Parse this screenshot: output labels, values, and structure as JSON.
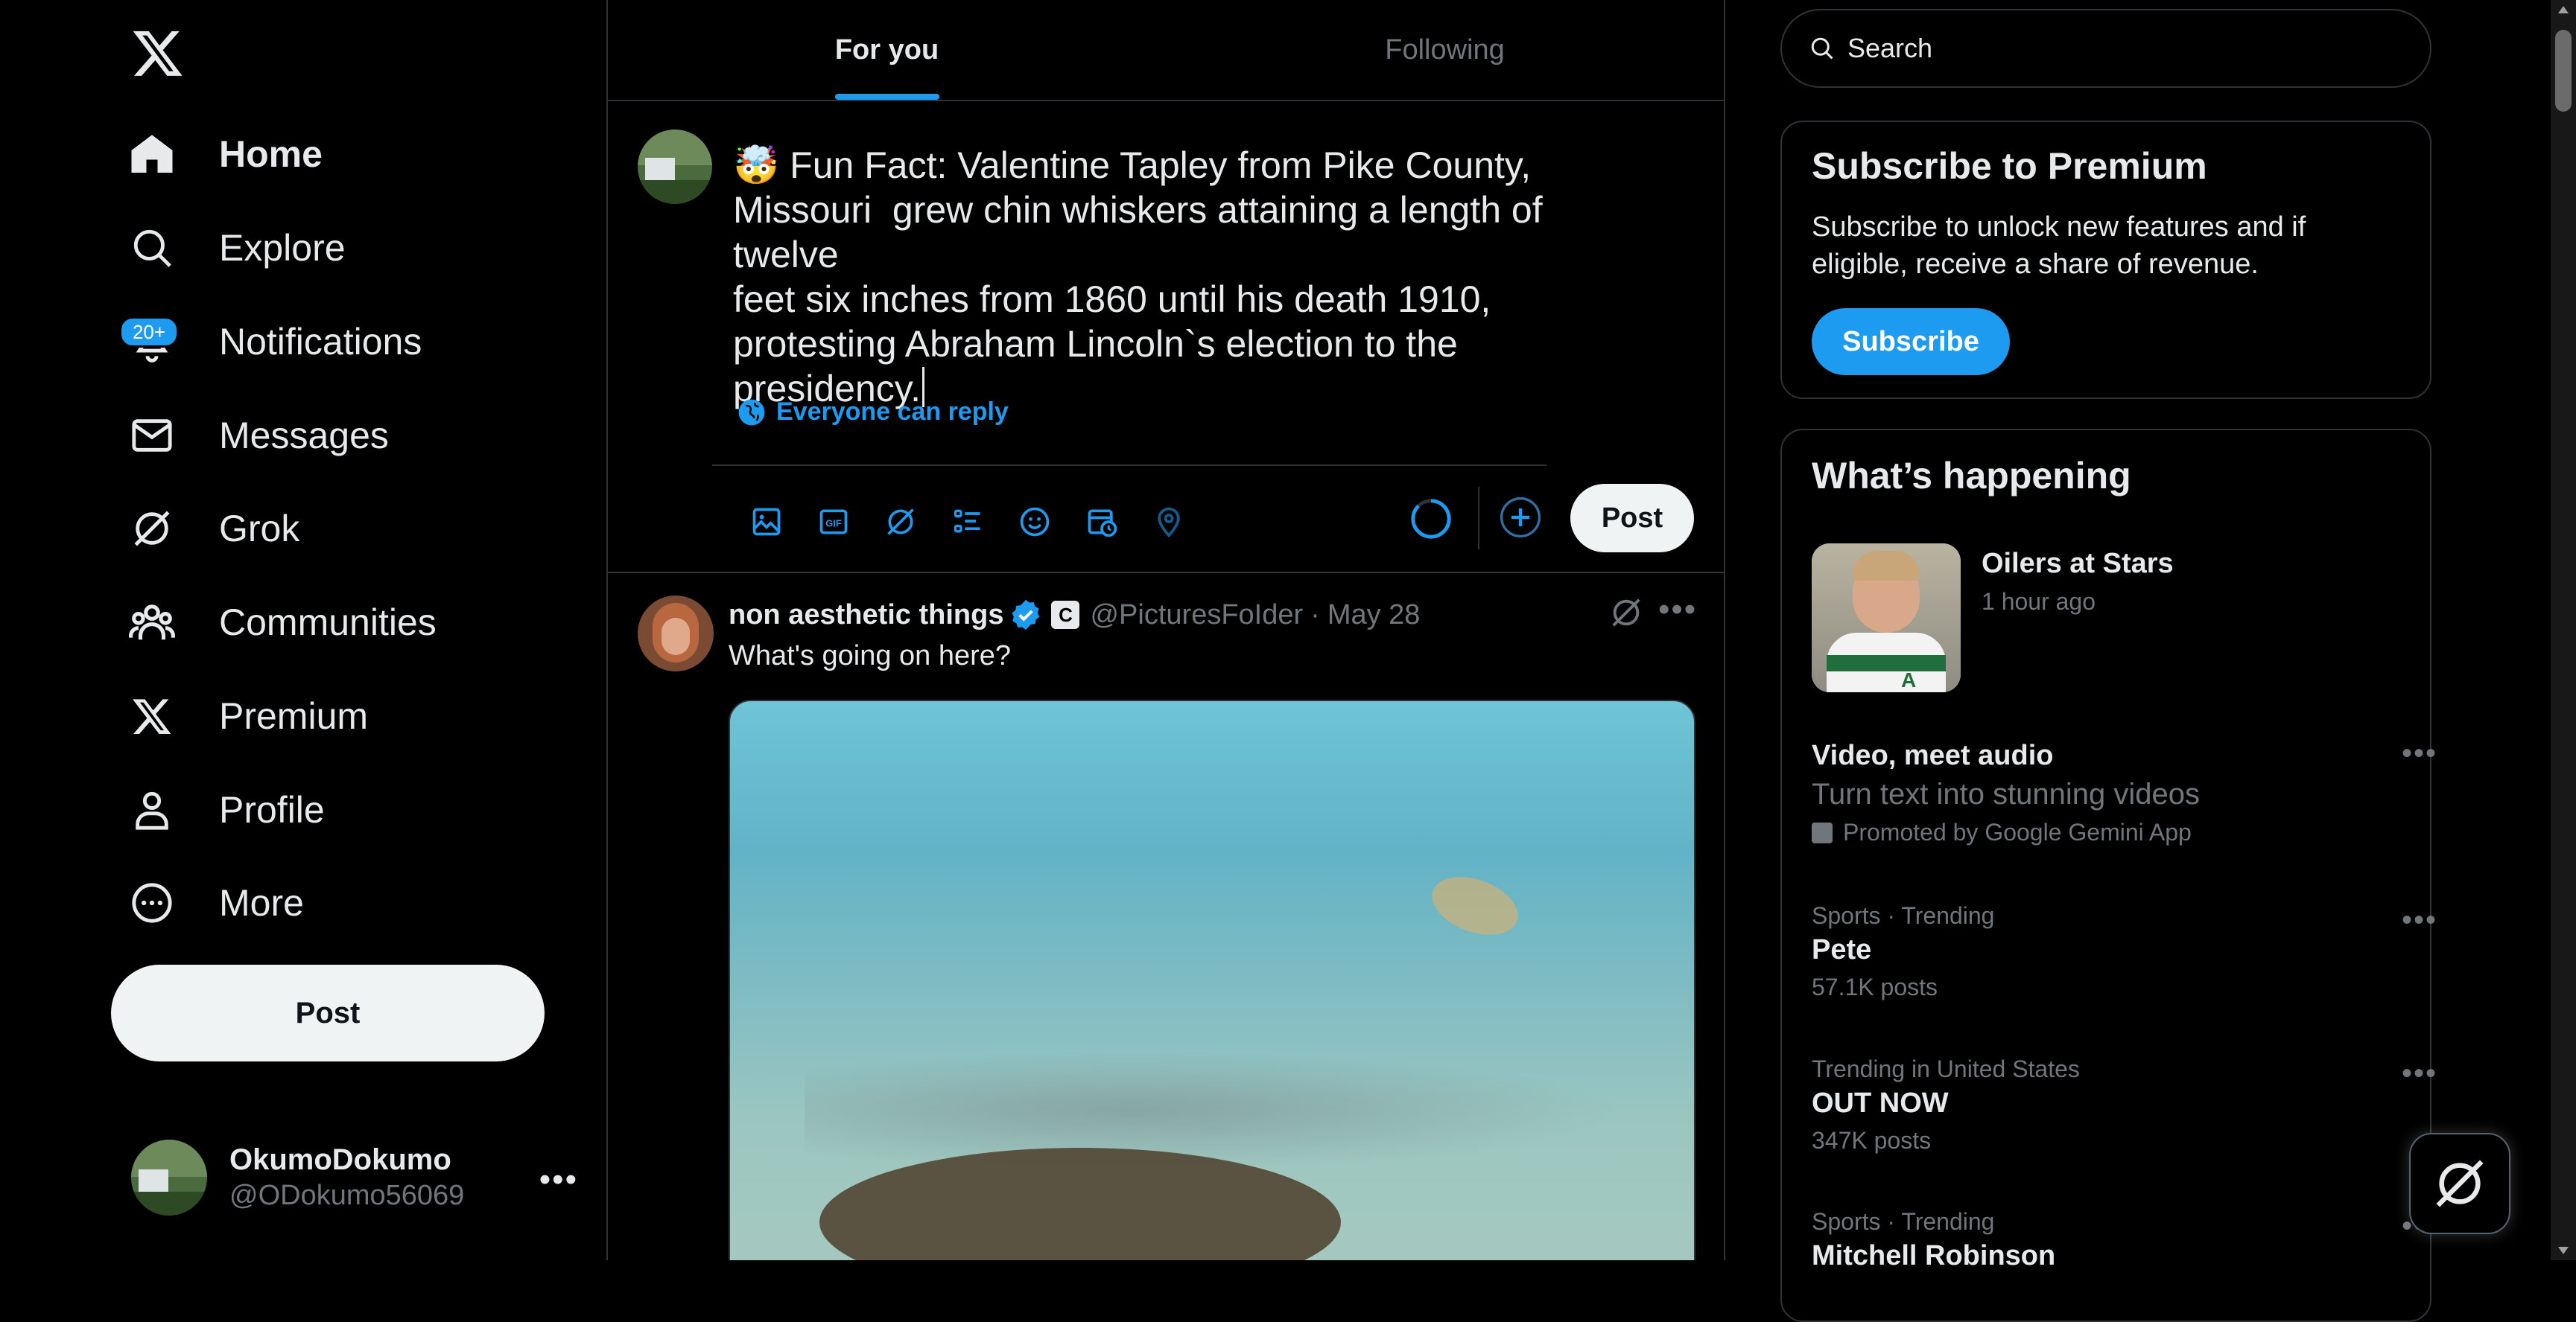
{
  "sidebar": {
    "logo_icon": "x-logo-icon",
    "items": [
      {
        "label": "Home",
        "icon": "home-icon"
      },
      {
        "label": "Explore",
        "icon": "search-icon"
      },
      {
        "label": "Notifications",
        "icon": "bell-icon",
        "badge": "20+"
      },
      {
        "label": "Messages",
        "icon": "envelope-icon"
      },
      {
        "label": "Grok",
        "icon": "grok-icon"
      },
      {
        "label": "Communities",
        "icon": "people-icon"
      },
      {
        "label": "Premium",
        "icon": "x-logo-icon"
      },
      {
        "label": "Profile",
        "icon": "person-icon"
      },
      {
        "label": "More",
        "icon": "more-circle-icon"
      }
    ],
    "post_button": "Post",
    "account": {
      "display_name": "OkumoDokumo",
      "handle": "@ODokumo56069"
    }
  },
  "tabs": [
    {
      "label": "For you",
      "active": true
    },
    {
      "label": "Following",
      "active": false
    }
  ],
  "composer": {
    "emoji": "🤯",
    "text": "Fun Fact: Valentine Tapley from Pike County,\nMissouri  grew chin whiskers attaining a length of twelve\nfeet six inches from 1860 until his death 1910,\nprotesting Abraham Lincoln`s election to the\npresidency.",
    "reply_setting": "Everyone can reply",
    "post_button": "Post",
    "tools": [
      "image-icon",
      "gif-icon",
      "grok-icon",
      "poll-icon",
      "emoji-icon",
      "schedule-icon",
      "location-icon"
    ]
  },
  "tweet": {
    "display_name": "non aesthetic things",
    "handle": "@PicturesFoIder",
    "date": "May 28",
    "separator": "·",
    "badge_letter": "C",
    "text": "What's going on here?"
  },
  "right": {
    "search_placeholder": "Search",
    "premium": {
      "title": "Subscribe to Premium",
      "text": "Subscribe to unlock new features and if eligible, receive a share of revenue.",
      "button": "Subscribe"
    },
    "trending": {
      "title": "What’s happening",
      "event": {
        "title": "Oilers at Stars",
        "time": "1 hour ago",
        "jersey_letter": "A"
      },
      "items": [
        {
          "name": "Video, meet audio",
          "sub": "Turn text into stunning videos",
          "promo": "Promoted by Google Gemini App"
        },
        {
          "category": "Sports · Trending",
          "name": "Pete",
          "count": "57.1K posts"
        },
        {
          "category": "Trending in United States",
          "name": "OUT NOW",
          "count": "347K posts"
        },
        {
          "category": "Sports · Trending",
          "name": "Mitchell Robinson"
        }
      ]
    }
  },
  "colors": {
    "accent": "#1d9bf0",
    "background": "#000000",
    "border": "#2f3336",
    "muted": "#71767b",
    "text": "#e7e9ea"
  }
}
